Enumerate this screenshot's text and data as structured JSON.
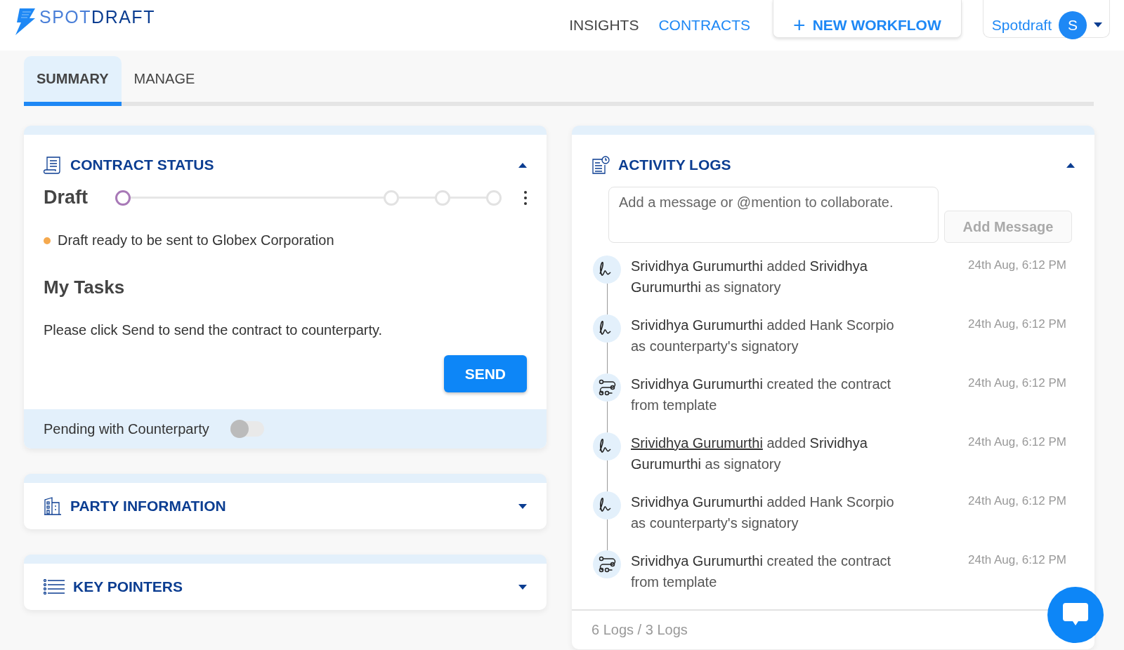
{
  "logo": "SPOT**DRAFT**",
  "nav": [
    {
      "label": "INSIGHTS",
      "selected": false
    },
    {
      "label": "CONTRACTS",
      "selected": true
    }
  ],
  "new_workflow_button": {
    "icon": "+",
    "label": "NEW WORKFLOW"
  },
  "account": {
    "name": "Spotdraft",
    "avatar": "S"
  },
  "tabs": [
    {
      "label": "SUMMARY",
      "selected": true
    },
    {
      "label": "MANAGE",
      "selected": false
    }
  ],
  "contract_status": {
    "title": "CONTRACT STATUS",
    "expanded": true,
    "status": "Draft",
    "steps": [
      {
        "selected": true
      },
      {
        "selected": false
      },
      {
        "selected": false
      },
      {
        "selected": false
      }
    ],
    "note": {
      "text": "Draft ready to be sent to Globex Corporation",
      "color": "#f5a94e"
    },
    "tasks_title": "My Tasks",
    "task_text": "Please click Send to send the contract to counterparty.",
    "send_button": "SEND",
    "pending_label": "Pending with Counterparty",
    "pending_on": false
  },
  "sections": [
    {
      "title": "PARTY INFORMATION",
      "kind": "building",
      "expanded": false
    },
    {
      "title": "KEY POINTERS",
      "kind": "list",
      "expanded": false
    }
  ],
  "activity_logs": {
    "title": "ACTIVITY LOGS",
    "expanded": true,
    "message_placeholder": "Add a message or @mention to collaborate.",
    "add_button": "Add Message",
    "entries": [
      {
        "kind": "signature",
        "actor": "Srividhya Gurumurthi",
        "actor_underlined": false,
        "text": "added **Srividhya Gurumurthi** as signatory",
        "time": "24th Aug, 6:12 PM"
      },
      {
        "kind": "signature",
        "actor": "Srividhya Gurumurthi",
        "actor_underlined": false,
        "text": "added Hank Scorpio as counterparty's signatory",
        "time": "24th Aug, 6:12 PM"
      },
      {
        "kind": "template",
        "actor": "Srividhya Gurumurthi",
        "actor_underlined": false,
        "text": "created the contract from template",
        "time": "24th Aug, 6:12 PM"
      },
      {
        "kind": "signature",
        "actor": "Srividhya Gurumurthi",
        "actor_underlined": true,
        "text": "added **Srividhya Gurumurthi** as signatory",
        "time": "24th Aug, 6:12 PM"
      },
      {
        "kind": "signature",
        "actor": "Srividhya Gurumurthi",
        "actor_underlined": false,
        "text": "added Hank Scorpio as counterparty's signatory",
        "time": "24th Aug, 6:12 PM"
      },
      {
        "kind": "template",
        "actor": "Srividhya Gurumurthi",
        "actor_underlined": false,
        "text": "created the contract from template",
        "time": "24th Aug, 6:12 PM"
      }
    ],
    "footer": "6 Logs / 3 Logs"
  }
}
